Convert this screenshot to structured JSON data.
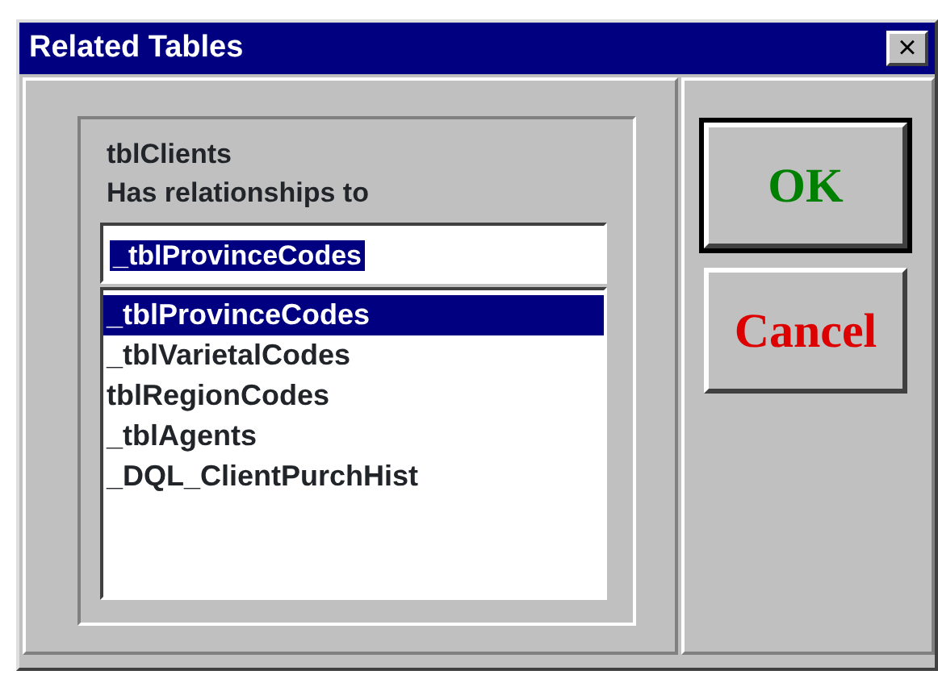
{
  "window": {
    "title": "Related Tables",
    "close": "×"
  },
  "group": {
    "table": "tblClients",
    "caption": "Has relationships to"
  },
  "combo": {
    "value": "_tblProvinceCodes"
  },
  "list": [
    {
      "label": "_tblProvinceCodes",
      "selected": true
    },
    {
      "label": "_tblVarietalCodes",
      "selected": false
    },
    {
      "label": "tblRegionCodes",
      "selected": false
    },
    {
      "label": "_tblAgents",
      "selected": false
    },
    {
      "label": "_DQL_ClientPurchHist",
      "selected": false
    }
  ],
  "buttons": [
    {
      "label": "OK",
      "color": "#008000",
      "default": true
    },
    {
      "label": "Cancel",
      "color": "#dd0000",
      "default": false
    }
  ]
}
